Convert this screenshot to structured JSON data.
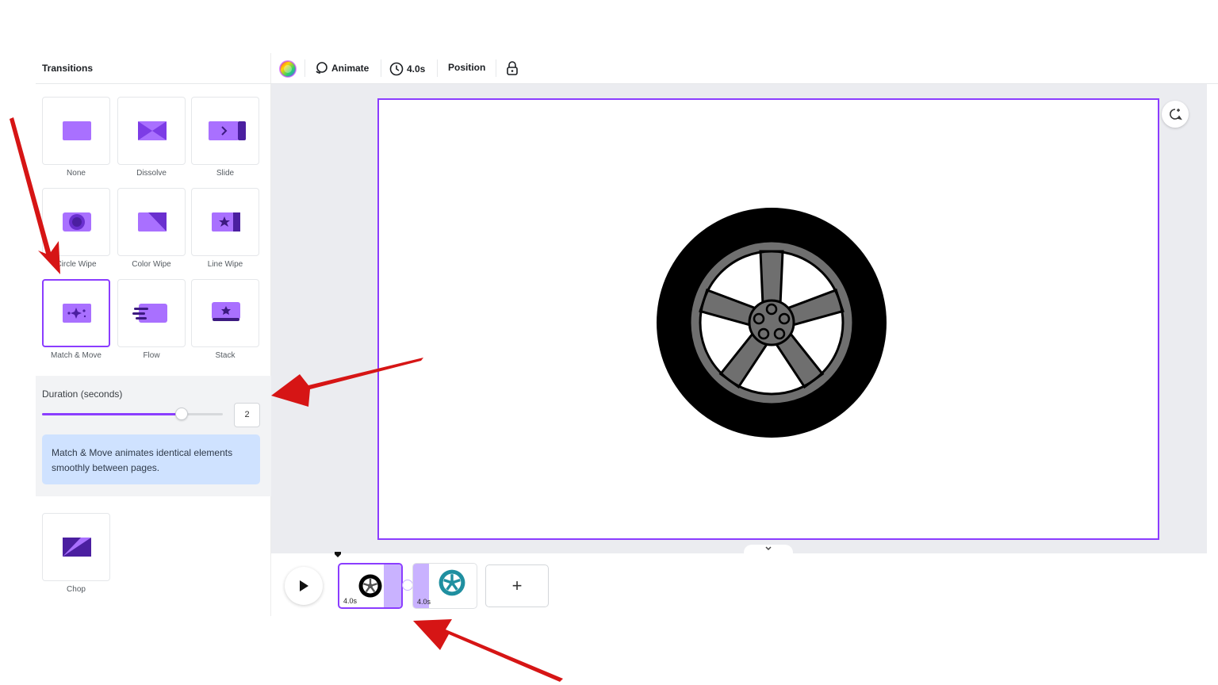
{
  "panel": {
    "title": "Transitions",
    "tiles": [
      {
        "label": "None"
      },
      {
        "label": "Dissolve"
      },
      {
        "label": "Slide"
      },
      {
        "label": "Circle Wipe"
      },
      {
        "label": "Color Wipe"
      },
      {
        "label": "Line Wipe"
      },
      {
        "label": "Match & Move",
        "selected": true
      },
      {
        "label": "Flow"
      },
      {
        "label": "Stack"
      },
      {
        "label": "Chop"
      }
    ],
    "duration": {
      "label": "Duration (seconds)",
      "value": "2",
      "slider_fraction": 0.77
    },
    "info": "Match & Move animates identical elements smoothly between pages."
  },
  "toolbar": {
    "animate_label": "Animate",
    "duration_label": "4.0s",
    "position_label": "Position"
  },
  "timeline": {
    "clips": [
      {
        "duration": "4.0s",
        "icon": "tire-icon"
      },
      {
        "duration": "4.0s",
        "icon": "teal-wheel-icon"
      }
    ],
    "add_label": "+"
  },
  "colors": {
    "accent": "#8b3dff",
    "tile_purple": "#a970ff",
    "tile_dark": "#4b1fa0",
    "info_bg": "#cfe2ff",
    "annotation_red": "#d61515"
  }
}
